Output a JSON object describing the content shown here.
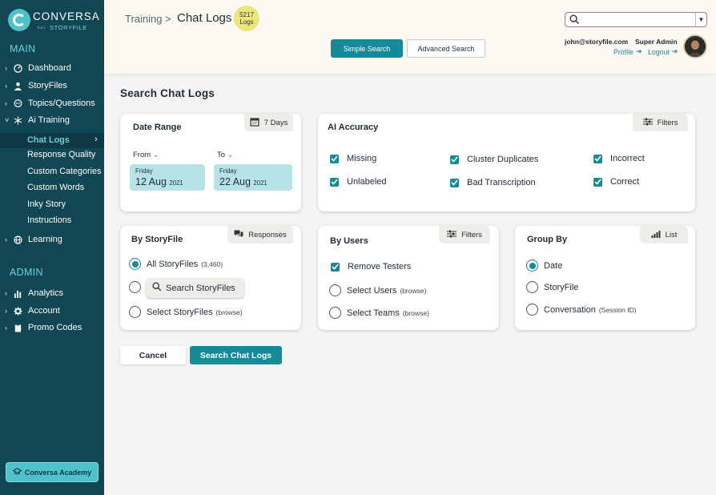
{
  "brand": {
    "name": "CONVERSA",
    "from": "from",
    "sub": "STORYFILE"
  },
  "sidebar": {
    "main_title": "MAIN",
    "admin_title": "ADMIN",
    "items": [
      {
        "label": "Dashboard",
        "icon": "dashboard-icon"
      },
      {
        "label": "StoryFiles",
        "icon": "person-icon"
      },
      {
        "label": "Topics/Questions",
        "icon": "chat-bubble-icon"
      },
      {
        "label": "Ai Training",
        "icon": "snowflake-icon"
      }
    ],
    "subitems": [
      "Chat Logs",
      "Response Quality",
      "Custom Categories",
      "Custom Words",
      "Inky Story",
      "Instructions"
    ],
    "learning": "Learning",
    "admin_items": [
      {
        "label": "Analytics",
        "icon": "bar-chart-icon"
      },
      {
        "label": "Account",
        "icon": "gear-icon"
      },
      {
        "label": "Promo Codes",
        "icon": "clipboard-icon"
      }
    ],
    "academy": "Conversa Academy"
  },
  "header": {
    "breadcrumb_root": "Training",
    "separator": ">",
    "current": "Chat Logs",
    "badge_count": "5217",
    "badge_label": "Logs",
    "simple_search": "Simple Search",
    "advanced_search": "Advanced Search",
    "search_placeholder": "",
    "user_email": "john@storyfile.com",
    "user_role": "Super Admin",
    "profile": "Profile",
    "logout": "Logout"
  },
  "main": {
    "title": "Search Chat Logs",
    "date_range": {
      "title": "Date Range",
      "chip": "7 Days",
      "from_label": "From",
      "to_label": "To",
      "from": {
        "day": "Friday",
        "date": "12 Aug",
        "year": "2021"
      },
      "to": {
        "day": "Friday",
        "date": "22 Aug",
        "year": "2021"
      }
    },
    "ai_accuracy": {
      "title": "AI Accuracy",
      "chip": "Filters",
      "options": [
        "Missing",
        "Cluster Duplicates",
        "Incorrect",
        "Unlabeled",
        "Bad Transcription",
        "Correct"
      ]
    },
    "by_storyfile": {
      "title": "By StoryFile",
      "chip": "Responses",
      "all_label": "All StoryFiles",
      "all_count": "(3,460)",
      "search_btn": "Search StoryFiles",
      "select_label": "Select StoryFiles",
      "select_hint": "(browse)"
    },
    "by_users": {
      "title": "By Users",
      "chip": "Filters",
      "remove_testers": "Remove Testers",
      "select_users": "Select Users",
      "select_teams": "Select Teams",
      "hint": "(browse)"
    },
    "group_by": {
      "title": "Group By",
      "chip": "List",
      "options": [
        "Date",
        "StoryFile",
        "Conversation"
      ],
      "conversation_hint": "(Session ID)"
    },
    "cancel": "Cancel",
    "submit": "Search Chat Logs"
  },
  "colors": {
    "sidebar": "#114654",
    "accent": "#158a98",
    "badge": "#ece57b",
    "datebox": "#b7e3e8"
  }
}
